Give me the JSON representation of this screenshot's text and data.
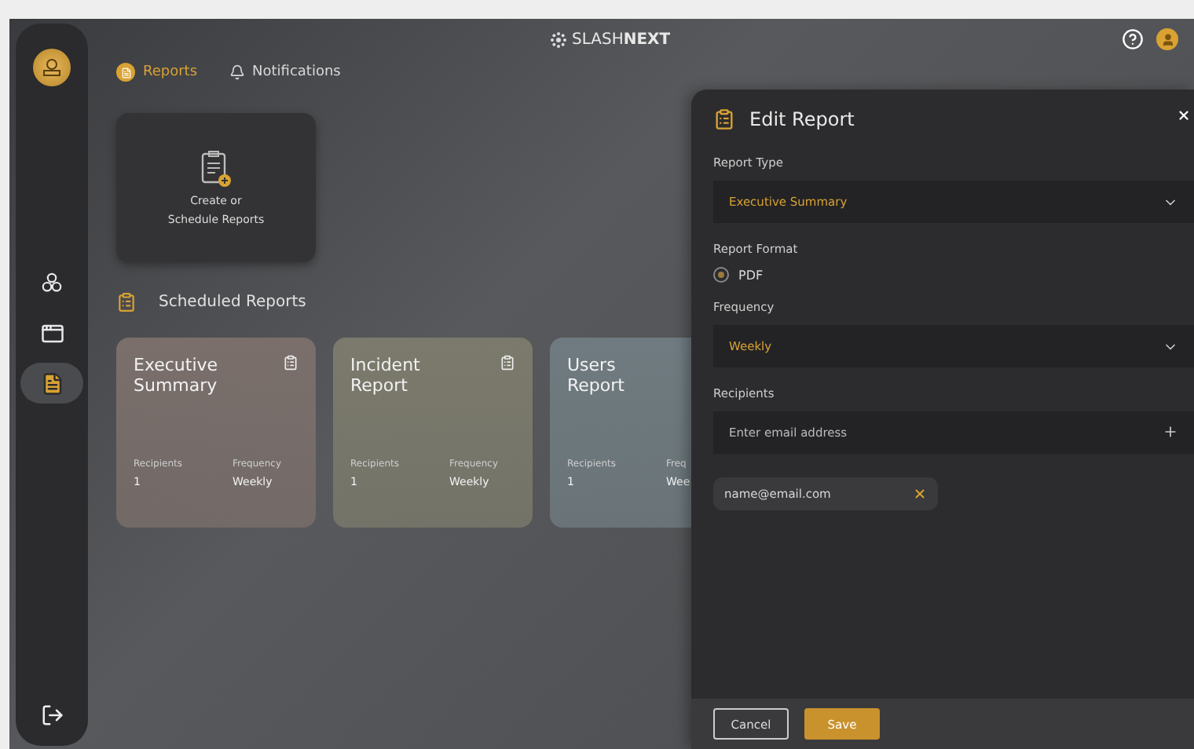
{
  "header": {
    "brand_light": "SLASH",
    "brand_bold": "NEXT"
  },
  "tabs": [
    {
      "label": "Reports",
      "selected": true
    },
    {
      "label": "Notifications",
      "selected": false
    }
  ],
  "sidebar": {
    "items": [
      {
        "kind": "network",
        "selected": false
      },
      {
        "kind": "browser",
        "selected": false
      },
      {
        "kind": "reports",
        "selected": true
      }
    ]
  },
  "create_card": {
    "lines": [
      "Create or",
      "Schedule Reports"
    ]
  },
  "scheduled": {
    "title": "Scheduled Reports",
    "cards": [
      {
        "title": "Executive Summary",
        "color": "#7a6f6b",
        "icon": true,
        "recipients_label": "Recipients",
        "recipients": "1",
        "frequency_label": "Frequency",
        "frequency": "Weekly"
      },
      {
        "title": "Incident Report",
        "color": "#7b7a6c",
        "icon": true,
        "recipients_label": "Recipients",
        "recipients": "1",
        "frequency_label": "Frequency",
        "frequency": "Weekly"
      },
      {
        "title": "Users Report",
        "color": "#6f7b80",
        "icon": false,
        "recipients_label": "Recipients",
        "recipients": "1",
        "frequency_label": "Freq",
        "frequency": "Wee"
      }
    ]
  },
  "panel": {
    "title": "Edit Report",
    "report_type_label": "Report Type",
    "report_type": "Executive Summary",
    "format_label": "Report Format",
    "formats": [
      {
        "label": "PDF",
        "selected": true
      }
    ],
    "frequency_label": "Frequency",
    "frequency": "Weekly",
    "recipients_label": "Recipients",
    "email_placeholder": "Enter email address",
    "chips": [
      "name@email.com"
    ],
    "buttons": {
      "cancel": "Cancel",
      "save": "Save"
    }
  }
}
